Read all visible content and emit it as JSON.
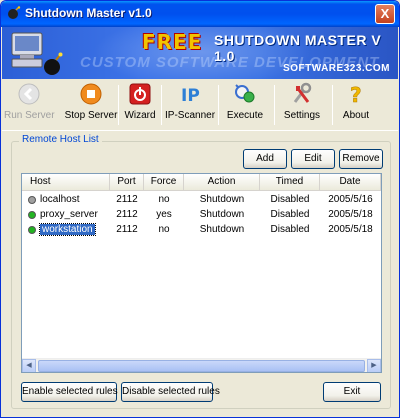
{
  "window": {
    "title": "Shutdown Master v1.0",
    "close_label": "X"
  },
  "banner": {
    "free": "FREE",
    "product": "SHUTDOWN MASTER V 1.0",
    "tagline": "CUSTOM SOFTWARE DEVELOPMENT",
    "site": "SOFTWARE323.COM"
  },
  "toolbar": {
    "items": [
      {
        "label": "Run Server",
        "icon": "run-server-icon",
        "enabled": false
      },
      {
        "label": "Stop Server",
        "icon": "stop-server-icon",
        "enabled": true
      },
      {
        "label": "Wizard",
        "icon": "wizard-icon",
        "enabled": true
      },
      {
        "label": "IP-Scanner",
        "icon": "ip-scanner-icon",
        "enabled": true
      },
      {
        "label": "Execute",
        "icon": "execute-icon",
        "enabled": true
      },
      {
        "label": "Settings",
        "icon": "settings-icon",
        "enabled": true
      },
      {
        "label": "About",
        "icon": "about-icon",
        "enabled": true
      }
    ]
  },
  "remote_hosts": {
    "group_title": "Remote Host List",
    "buttons": {
      "add": "Add",
      "edit": "Edit",
      "remove": "Remove"
    },
    "columns": [
      "Host",
      "Port",
      "Force",
      "Action",
      "Timed",
      "Date"
    ],
    "rows": [
      {
        "host": "localhost",
        "port": "2112",
        "force": "no",
        "action": "Shutdown",
        "timed": "Disabled",
        "date": "2005/5/16",
        "status_color": "#a0a0a0",
        "selected": false
      },
      {
        "host": "proxy_server",
        "port": "2112",
        "force": "yes",
        "action": "Shutdown",
        "timed": "Disabled",
        "date": "2005/5/18",
        "status_color": "#22b422",
        "selected": false
      },
      {
        "host": "workstation",
        "port": "2112",
        "force": "no",
        "action": "Shutdown",
        "timed": "Disabled",
        "date": "2005/5/18",
        "status_color": "#22b422",
        "selected": true
      }
    ],
    "footer": {
      "enable": "Enable selected rules",
      "disable": "Disable selected rules",
      "exit": "Exit"
    }
  }
}
